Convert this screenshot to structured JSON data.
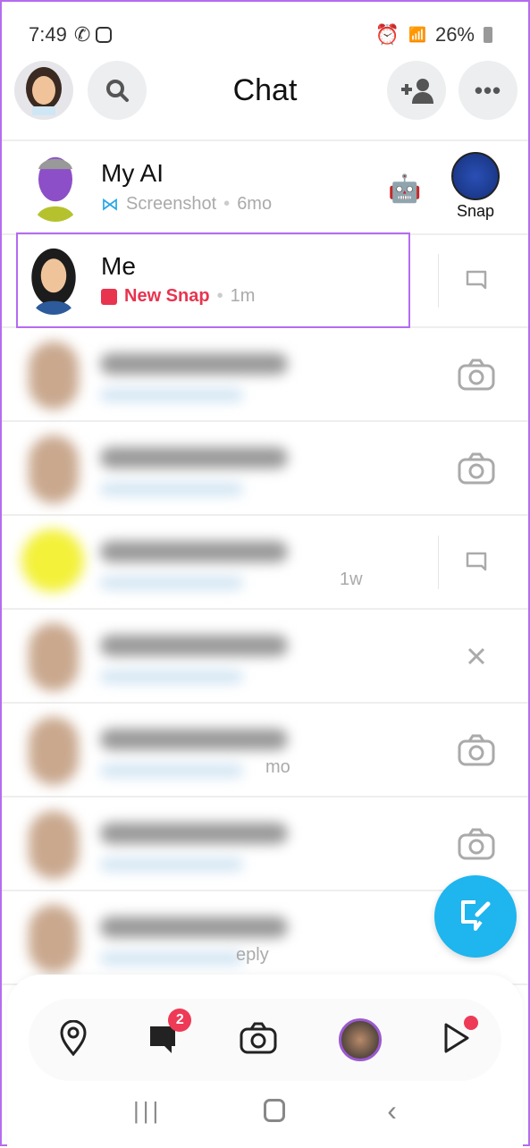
{
  "status_bar": {
    "time": "7:49",
    "battery": "26%",
    "icons": [
      "whatsapp-icon",
      "instagram-icon",
      "battery-saver-icon",
      "alarm-icon",
      "wifi-icon",
      "volte-icon",
      "signal-icon",
      "battery-icon"
    ]
  },
  "header": {
    "title": "Chat"
  },
  "chats": [
    {
      "name": "My AI",
      "status_icon": "screenshot-icon",
      "status": "Screenshot",
      "time": "6mo",
      "emoji": "🤖",
      "snap_label": "Snap"
    },
    {
      "name": "Me",
      "status_icon": "new-snap-icon",
      "status": "New Snap",
      "time": "1m",
      "status_color": "#e8344f",
      "highlight_color": "#b46cf0"
    }
  ],
  "blurred_rows": [
    {
      "partial": "",
      "action": "camera"
    },
    {
      "partial": "",
      "action": "camera"
    },
    {
      "partial": "1w",
      "action": "chat"
    },
    {
      "partial": "",
      "action": "close"
    },
    {
      "partial": "mo",
      "action": "camera"
    },
    {
      "partial": "",
      "action": "camera"
    },
    {
      "partial": "eply",
      "action": ""
    }
  ],
  "bottom_nav": {
    "chat_badge": "2",
    "items": [
      "map",
      "chat",
      "camera",
      "stories",
      "spotlight"
    ]
  },
  "accent": "#1fb5ee"
}
